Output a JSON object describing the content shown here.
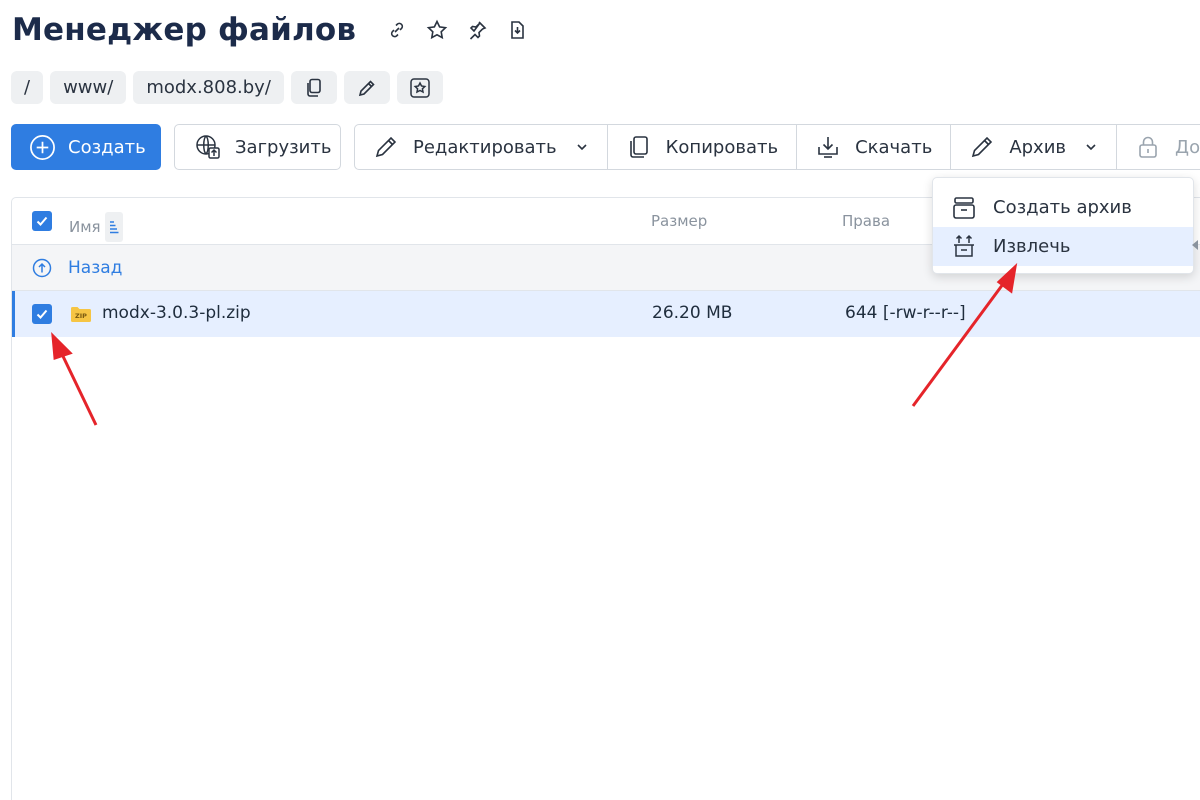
{
  "header": {
    "title": "Менеджер файлов",
    "icons": [
      "link-icon",
      "star-icon",
      "pin-icon",
      "bookmark-download-icon"
    ]
  },
  "breadcrumb": {
    "items": [
      "/",
      "www/",
      "modx.808.by/"
    ],
    "icons": [
      "copy-icon",
      "pencil-icon",
      "star-add-icon"
    ]
  },
  "toolbar": {
    "create_label": "Создать",
    "upload_label": "Загрузить",
    "edit_label": "Редактировать",
    "copy_label": "Копировать",
    "download_label": "Скачать",
    "archive_label": "Архив",
    "access_label": "Досту"
  },
  "table": {
    "columns": {
      "name": "Имя",
      "size": "Размер",
      "perm": "Права"
    },
    "back_label": "Назад",
    "rows": [
      {
        "name": "modx-3.0.3-pl.zip",
        "size": "26.20 MB",
        "perm": "644 [-rw-r--r--]",
        "selected": true,
        "icon_text": "ZIP"
      }
    ]
  },
  "archive_menu": {
    "items": [
      "Создать архив",
      "Извлечь"
    ],
    "active_index": 1
  },
  "colors": {
    "accent": "#2f7de1",
    "title": "#1c2b4a",
    "arrow": "#e5242a",
    "selected_row": "#e6efff"
  }
}
